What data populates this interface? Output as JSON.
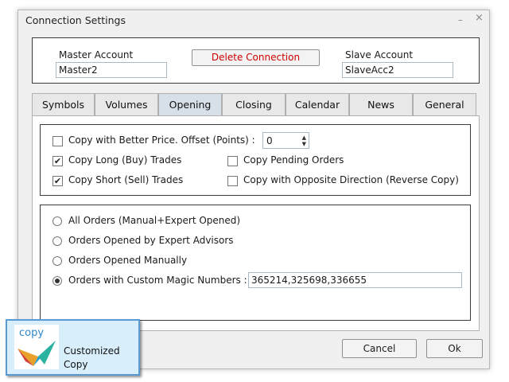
{
  "window": {
    "title": "Connection Settings",
    "minimize_glyph": "–",
    "close_glyph": "×"
  },
  "accounts": {
    "master_label": "Master Account",
    "master_value": "Master2",
    "delete_label": "Delete Connection",
    "slave_label": "Slave Account",
    "slave_value": "SlaveAcc2"
  },
  "tabs": [
    {
      "label": "Symbols",
      "active": false
    },
    {
      "label": "Volumes",
      "active": false
    },
    {
      "label": "Opening",
      "active": true
    },
    {
      "label": "Closing",
      "active": false
    },
    {
      "label": "Calendar",
      "active": false
    },
    {
      "label": "News",
      "active": false
    },
    {
      "label": "General",
      "active": false
    }
  ],
  "opening": {
    "better_price": {
      "label": "Copy with Better Price. Offset (Points) :",
      "checked": false
    },
    "offset_value": "0",
    "long_trades": {
      "label": "Copy Long (Buy) Trades",
      "checked": true
    },
    "short_trades": {
      "label": "Copy Short (Sell) Trades",
      "checked": true
    },
    "pending_orders": {
      "label": "Copy Pending Orders",
      "checked": false
    },
    "opposite_direction": {
      "label": "Copy with Opposite Direction (Reverse Copy)",
      "checked": false
    }
  },
  "orders": {
    "options": [
      {
        "label": "All Orders (Manual+Expert Opened)",
        "selected": false
      },
      {
        "label": "Orders Opened by Expert Advisors",
        "selected": false
      },
      {
        "label": "Orders Opened Manually",
        "selected": false
      },
      {
        "label": "Orders with Custom Magic Numbers :",
        "selected": true
      }
    ],
    "magic_numbers": "365214,325698,336655"
  },
  "buttons": {
    "cancel": "Cancel",
    "ok": "Ok"
  },
  "badge": {
    "logo_text": "copy",
    "line1": "Customized",
    "line2": "Copy"
  },
  "colors": {
    "delete_text": "#cc0000",
    "active_tab": "#d7dfe8",
    "badge_bg": "#d9eefb",
    "badge_border": "#5a9bd4"
  },
  "icons": {
    "checked": "✔"
  }
}
